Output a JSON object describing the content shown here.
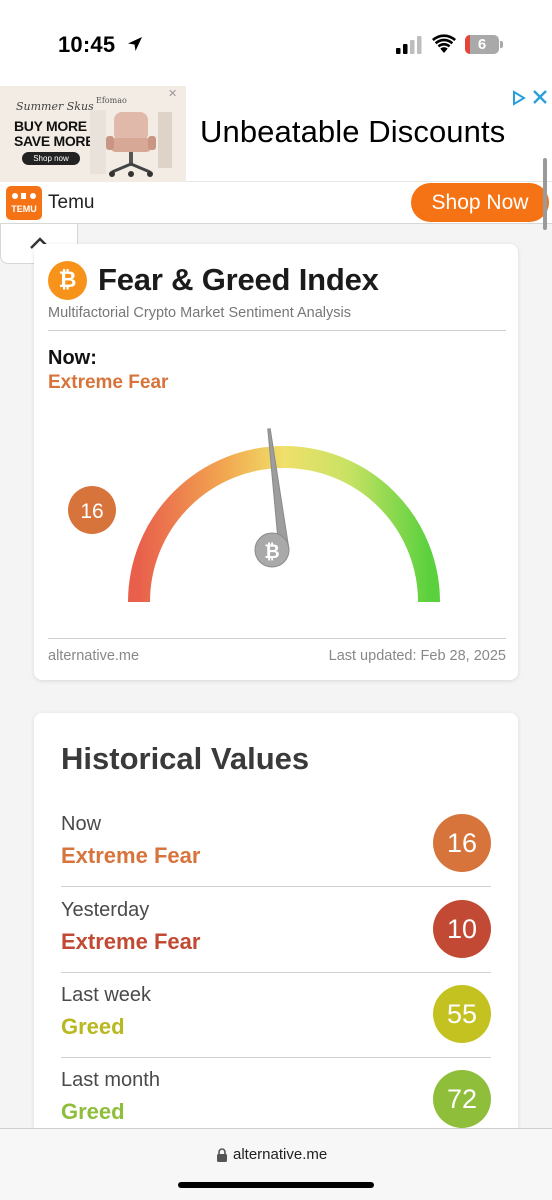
{
  "status_bar": {
    "time": "10:45",
    "battery_level": "6",
    "battery_color": "#e5443a"
  },
  "ad": {
    "image": {
      "script_text": "Summer Skus",
      "headline_line1": "BUY MORE",
      "headline_line2": "SAVE MORE",
      "button_text": "Shop now",
      "brand": "Efomao"
    },
    "headline": "Unbeatable Discounts",
    "advertiser": "Temu",
    "logo_text": "TEMU",
    "cta": "Shop Now",
    "accent": "#f57314"
  },
  "fng_card": {
    "title": "Fear & Greed Index",
    "subtitle": "Multifactorial Crypto Market Sentiment Analysis",
    "now_label": "Now:",
    "now_classification": "Extreme Fear",
    "value": 16,
    "value_color": "#d7743c",
    "gauge_scale": [
      0,
      100
    ],
    "site": "alternative.me",
    "last_updated": "Last updated: Feb 28, 2025"
  },
  "historical": {
    "title": "Historical Values",
    "rows": [
      {
        "label": "Now",
        "classification": "Extreme Fear",
        "value": "16",
        "color": "#d7743c",
        "text_color": "#d7743c"
      },
      {
        "label": "Yesterday",
        "classification": "Extreme Fear",
        "value": "10",
        "color": "#c24a34",
        "text_color": "#c24a34"
      },
      {
        "label": "Last week",
        "classification": "Greed",
        "value": "55",
        "color": "#c4c221",
        "text_color": "#b8b820"
      },
      {
        "label": "Last month",
        "classification": "Greed",
        "value": "72",
        "color": "#8fbe3a",
        "text_color": "#8fbe3a"
      }
    ]
  },
  "browser": {
    "url": "alternative.me"
  }
}
